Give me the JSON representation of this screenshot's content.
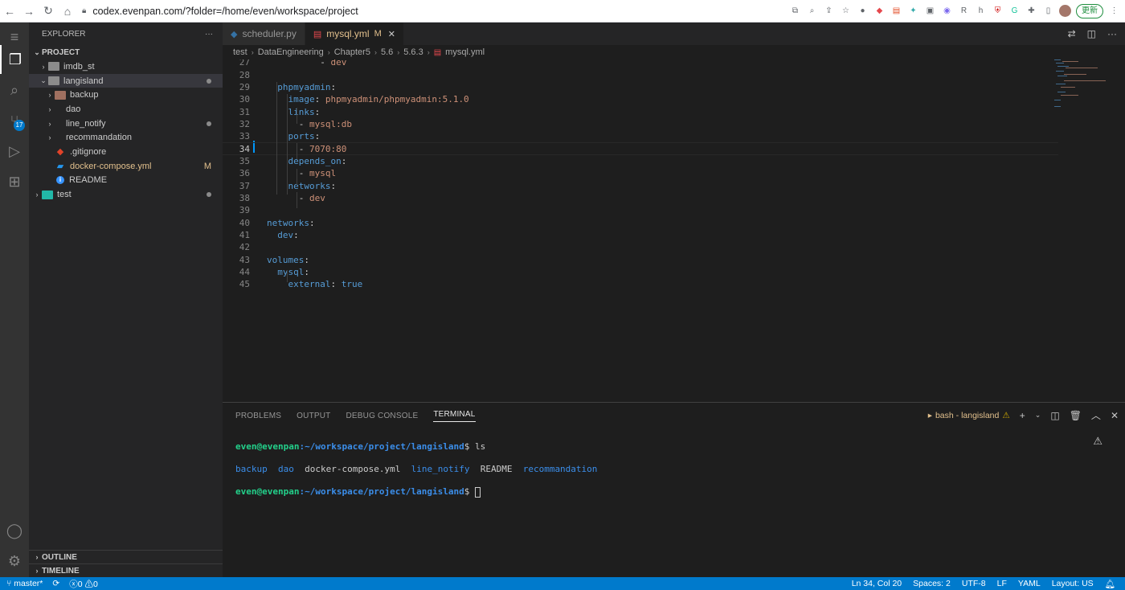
{
  "browser": {
    "url": "codex.evenpan.com/?folder=/home/even/workspace/project",
    "update_label": "更新"
  },
  "activity": {
    "scm_badge": "17"
  },
  "sidebar": {
    "title": "EXPLORER",
    "more": "···",
    "root": "PROJECT",
    "items": [
      {
        "label": "imdb_st"
      },
      {
        "label": "langisland"
      },
      {
        "label": "backup"
      },
      {
        "label": "dao"
      },
      {
        "label": "line_notify"
      },
      {
        "label": "recommandation"
      },
      {
        "label": ".gitignore"
      },
      {
        "label": "docker-compose.yml",
        "status": "M"
      },
      {
        "label": "README"
      },
      {
        "label": "test"
      }
    ],
    "outline": "OUTLINE",
    "timeline": "TIMELINE"
  },
  "tabs": [
    {
      "label": "scheduler.py"
    },
    {
      "label": "mysql.yml",
      "status": "M",
      "close": "✕"
    }
  ],
  "breadcrumb": [
    "test",
    "DataEngineering",
    "Chapter5",
    "5.6",
    "5.6.3",
    "mysql.yml"
  ],
  "editor": {
    "lines": [
      {
        "n": "27",
        "parts": [
          [
            "pl",
            "          - "
          ],
          [
            "str",
            "dev"
          ]
        ]
      },
      {
        "n": "28",
        "parts": []
      },
      {
        "n": "29",
        "parts": [
          [
            "pl",
            "  "
          ],
          [
            "kw",
            "phpmyadmin"
          ],
          [
            "pl",
            ":"
          ]
        ]
      },
      {
        "n": "30",
        "parts": [
          [
            "pl",
            "    "
          ],
          [
            "kw",
            "image"
          ],
          [
            "pl",
            ": "
          ],
          [
            "str",
            "phpmyadmin/phpmyadmin:5.1.0"
          ]
        ]
      },
      {
        "n": "31",
        "parts": [
          [
            "pl",
            "    "
          ],
          [
            "kw",
            "links"
          ],
          [
            "pl",
            ":"
          ]
        ]
      },
      {
        "n": "32",
        "parts": [
          [
            "pl",
            "      - "
          ],
          [
            "str",
            "mysql:db"
          ]
        ]
      },
      {
        "n": "33",
        "parts": [
          [
            "pl",
            "    "
          ],
          [
            "kw",
            "ports"
          ],
          [
            "pl",
            ":"
          ]
        ]
      },
      {
        "n": "34",
        "parts": [
          [
            "pl",
            "      - "
          ],
          [
            "str",
            "7070:80"
          ]
        ]
      },
      {
        "n": "35",
        "parts": [
          [
            "pl",
            "    "
          ],
          [
            "kw",
            "depends_on"
          ],
          [
            "pl",
            ":"
          ]
        ]
      },
      {
        "n": "36",
        "parts": [
          [
            "pl",
            "      - "
          ],
          [
            "str",
            "mysql"
          ]
        ]
      },
      {
        "n": "37",
        "parts": [
          [
            "pl",
            "    "
          ],
          [
            "kw",
            "networks"
          ],
          [
            "pl",
            ":"
          ]
        ]
      },
      {
        "n": "38",
        "parts": [
          [
            "pl",
            "      - "
          ],
          [
            "str",
            "dev"
          ]
        ]
      },
      {
        "n": "39",
        "parts": []
      },
      {
        "n": "40",
        "parts": [
          [
            "kw",
            "networks"
          ],
          [
            "pl",
            ":"
          ]
        ]
      },
      {
        "n": "41",
        "parts": [
          [
            "pl",
            "  "
          ],
          [
            "kw",
            "dev"
          ],
          [
            "pl",
            ":"
          ]
        ]
      },
      {
        "n": "42",
        "parts": []
      },
      {
        "n": "43",
        "parts": [
          [
            "kw",
            "volumes"
          ],
          [
            "pl",
            ":"
          ]
        ]
      },
      {
        "n": "44",
        "parts": [
          [
            "pl",
            "  "
          ],
          [
            "kw",
            "mysql"
          ],
          [
            "pl",
            ":"
          ]
        ]
      },
      {
        "n": "45",
        "parts": [
          [
            "pl",
            "    "
          ],
          [
            "kw",
            "external"
          ],
          [
            "pl",
            ": "
          ],
          [
            "kw",
            "true"
          ]
        ]
      }
    ]
  },
  "panel": {
    "tabs": [
      "PROBLEMS",
      "OUTPUT",
      "DEBUG CONSOLE",
      "TERMINAL"
    ],
    "terminal_name": "bash - langisland",
    "terminal": {
      "user": "even@evenpan",
      "path": ":~/workspace/project/langisland",
      "prompt": "$ ",
      "cmd": "ls",
      "ls": [
        "backup",
        "dao",
        "docker-compose.yml",
        "line_notify",
        "README",
        "recommandation"
      ]
    }
  },
  "status": {
    "branch": "master*",
    "errors": "0",
    "warnings": "0",
    "position": "Ln 34, Col 20",
    "spaces": "Spaces: 2",
    "encoding": "UTF-8",
    "eol": "LF",
    "language": "YAML",
    "layout": "Layout: US"
  },
  "colors": {
    "accent": "#007acc",
    "keyword": "#569cd6",
    "string": "#ce9178"
  }
}
